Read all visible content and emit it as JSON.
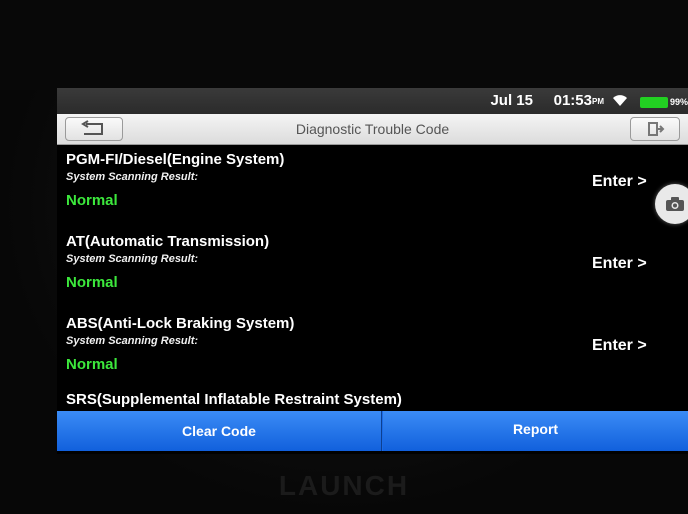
{
  "status_bar": {
    "date": "Jul 15",
    "time": "01:53",
    "ampm": "PM",
    "battery": "99%",
    "battery_color": "#22d022",
    "wifi_icon": "wifi-icon"
  },
  "title_bar": {
    "title": "Diagnostic Trouble Code",
    "back_icon": "back-arrow-icon",
    "exit_icon": "exit-icon"
  },
  "systems": [
    {
      "name": "PGM-FI/Diesel(Engine System)",
      "scan_label": "System Scanning Result:",
      "status": "Normal",
      "enter": "Enter >"
    },
    {
      "name": "AT(Automatic Transmission)",
      "scan_label": "System Scanning Result:",
      "status": "Normal",
      "enter": "Enter >"
    },
    {
      "name": "ABS(Anti-Lock Braking System)",
      "scan_label": "System Scanning Result:",
      "status": "Normal",
      "enter": "Enter >"
    }
  ],
  "partial_system": {
    "name": "SRS(Supplemental Inflatable Restraint System)"
  },
  "buttons": {
    "clear_code": "Clear Code",
    "report": "Report"
  },
  "camera_icon": "camera-icon",
  "brand": "LAUNCH",
  "colors": {
    "accent": "#1a6be6",
    "status_normal": "#3ce83c"
  }
}
